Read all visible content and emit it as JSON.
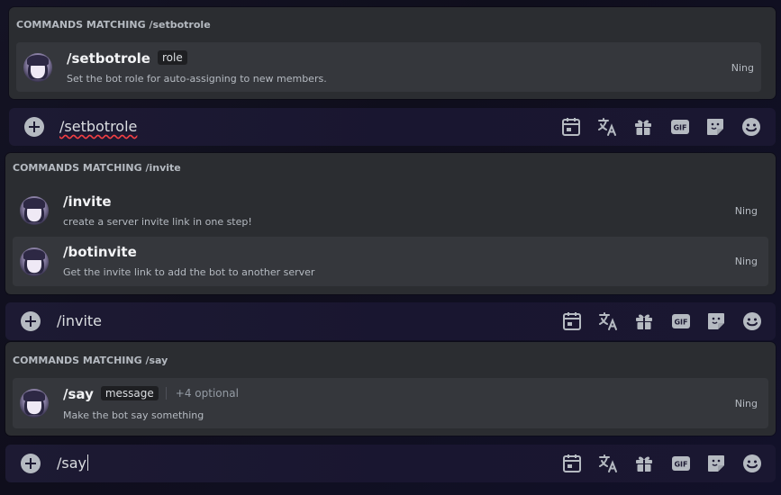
{
  "groups": [
    {
      "header": "COMMANDS MATCHING /setbotrole",
      "commands": [
        {
          "name": "/setbotrole",
          "param": "role",
          "desc": "Set the bot role for auto-assigning to new members.",
          "source": "Ning"
        }
      ],
      "input_value": "/setbotrole"
    },
    {
      "header": "COMMANDS MATCHING /invite",
      "commands": [
        {
          "name": "/invite",
          "desc": "create a server invite link in one step!",
          "source": "Ning"
        },
        {
          "name": "/botinvite",
          "desc": "Get the invite link to add the bot to another server",
          "source": "Ning"
        }
      ],
      "input_value": "/invite"
    },
    {
      "header": "COMMANDS MATCHING /say",
      "commands": [
        {
          "name": "/say",
          "param": "message",
          "optional": "+4 optional",
          "desc": "Make the bot say something",
          "source": "Ning"
        }
      ],
      "input_value": "/say"
    }
  ],
  "toolbar": {
    "gif_label": "GIF",
    "icons": [
      "schedule-icon",
      "translate-icon",
      "gift-icon",
      "gif-icon",
      "sticker-icon",
      "emoji-icon"
    ]
  },
  "colors": {
    "panel": "#2b2d31",
    "active_row": "#35373c",
    "input_bar": "#1d1a33",
    "spellcheck": "#f23f43"
  }
}
